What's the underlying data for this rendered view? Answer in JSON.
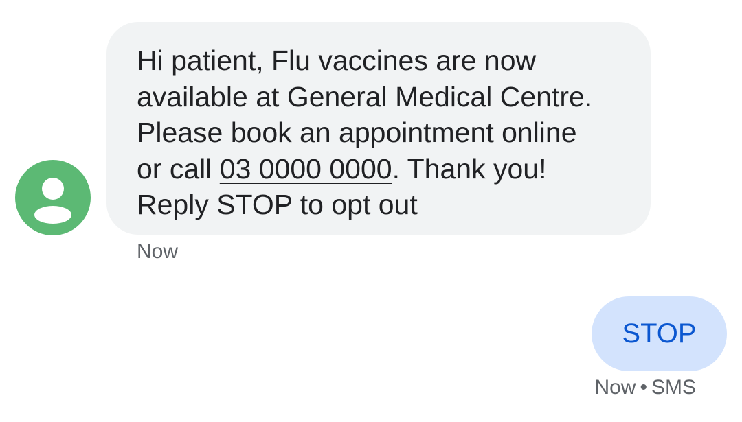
{
  "conversation": {
    "incoming": {
      "avatar_icon": "person-icon",
      "avatar_color": "#5cb974",
      "lines": [
        "Hi patient, Flu vaccines are now",
        "available at General Medical Centre.",
        "Please book an appointment online"
      ],
      "line4_prefix": "or call ",
      "phone": "03 0000 0000",
      "line4_suffix": ". Thank you!",
      "line5": "Reply STOP to opt out",
      "timestamp": "Now"
    },
    "outgoing": {
      "text": "STOP",
      "timestamp": "Now",
      "separator": "•",
      "channel": "SMS"
    }
  },
  "colors": {
    "incoming_bubble": "#f1f3f4",
    "outgoing_bubble": "#d3e3fd",
    "outgoing_text": "#0b57d0",
    "meta_text": "#5f6368"
  }
}
